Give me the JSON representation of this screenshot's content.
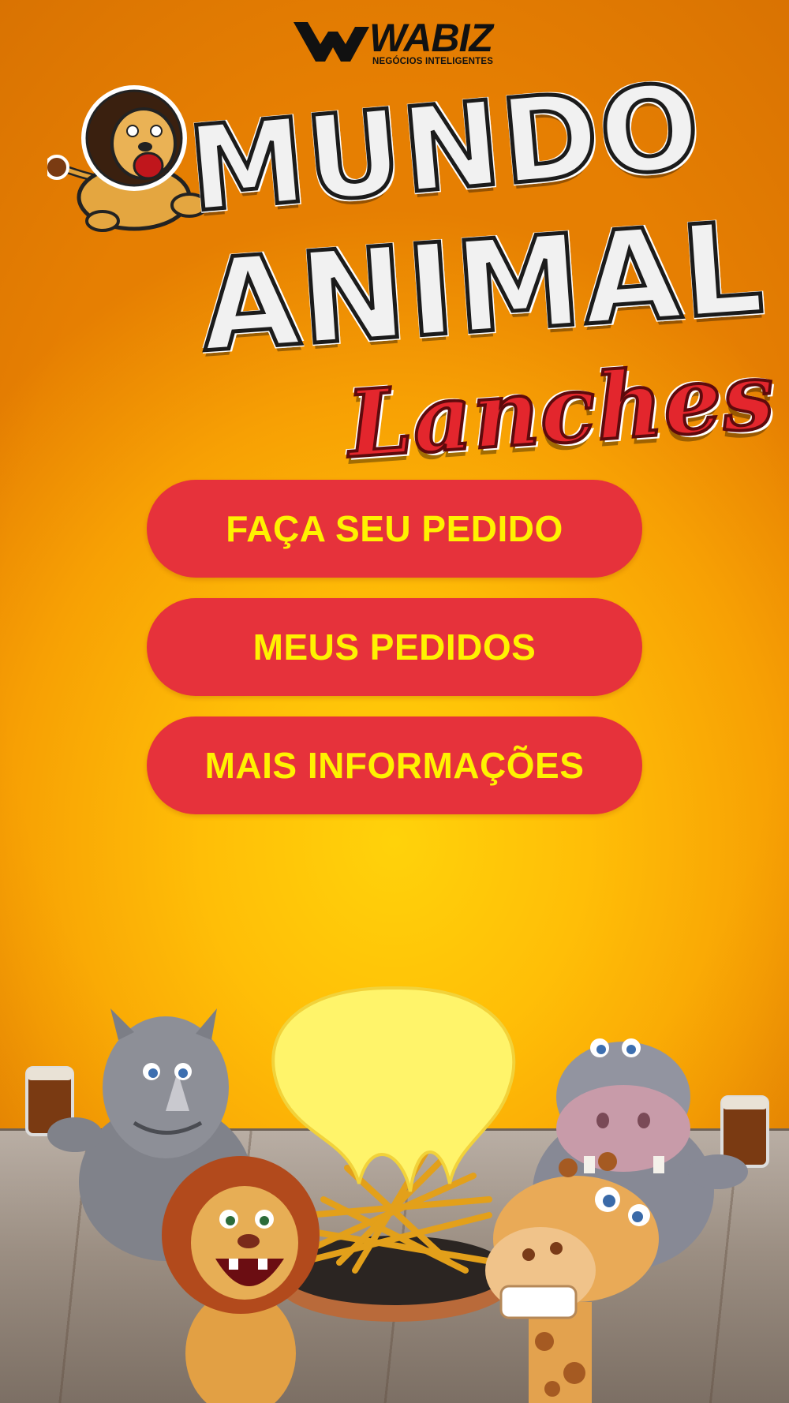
{
  "brand": {
    "name": "WABIZ",
    "tagline": "NEGÓCIOS INTELIGENTES",
    "logo_icon": "wabiz-chevron-icon"
  },
  "logo": {
    "line1": "MUNDO",
    "line2": "ANIMAL",
    "line3": "Lanches",
    "mascot_icon": "lion-mascot-icon"
  },
  "menu": {
    "order_label": "FAÇA SEU PEDIDO",
    "my_orders_label": "MEUS PEDIDOS",
    "more_info_label": "MAIS INFORMAÇÕES"
  },
  "colors": {
    "background": "#ffc20a",
    "button": "#e6323b",
    "button_text": "#fff200"
  },
  "illustration": {
    "characters": [
      "rhino-icon",
      "lion-icon",
      "fries-plate-icon",
      "giraffe-icon",
      "hippo-icon"
    ]
  }
}
